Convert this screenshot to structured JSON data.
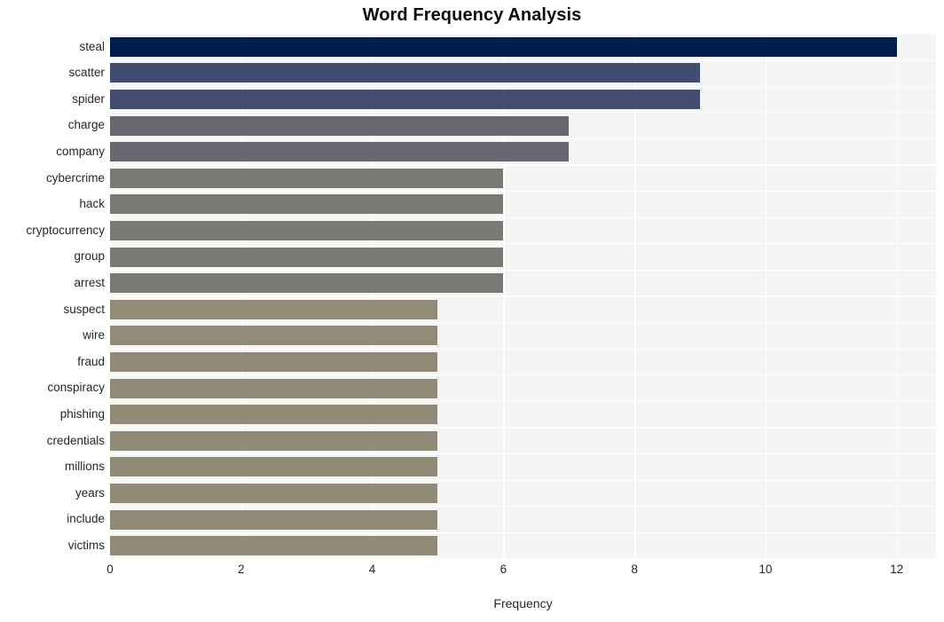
{
  "chart_data": {
    "type": "bar",
    "orientation": "horizontal",
    "title": "Word Frequency Analysis",
    "xlabel": "Frequency",
    "ylabel": "",
    "xlim": [
      0,
      12.6
    ],
    "ylim": [
      0,
      20
    ],
    "grid": true,
    "legend": null,
    "xticks": [
      "0",
      "2",
      "4",
      "6",
      "8",
      "10",
      "12"
    ],
    "xtick_values": [
      0,
      2,
      4,
      6,
      8,
      10,
      12
    ],
    "categories": [
      "steal",
      "scatter",
      "spider",
      "charge",
      "company",
      "cybercrime",
      "hack",
      "cryptocurrency",
      "group",
      "arrest",
      "suspect",
      "wire",
      "fraud",
      "conspiracy",
      "phishing",
      "credentials",
      "millions",
      "years",
      "include",
      "victims"
    ],
    "values": [
      12,
      9,
      9,
      7,
      7,
      6,
      6,
      6,
      6,
      6,
      5,
      5,
      5,
      5,
      5,
      5,
      5,
      5,
      5,
      5
    ],
    "bar_colors": [
      "#001f4d",
      "#414c71",
      "#434d70",
      "#67686f",
      "#67686f",
      "#7a7974",
      "#7a7974",
      "#7a7974",
      "#7a7974",
      "#7a7974",
      "#928b77",
      "#928b77",
      "#918a76",
      "#918a76",
      "#918a76",
      "#918a76",
      "#918a76",
      "#918a76",
      "#918a76",
      "#918a76"
    ],
    "plot_background": "#f5f5f6",
    "grid_color": "#ffffff",
    "figure_background": "#ffffff",
    "text_color": "#262626",
    "title_color": "#0d0d0d"
  }
}
